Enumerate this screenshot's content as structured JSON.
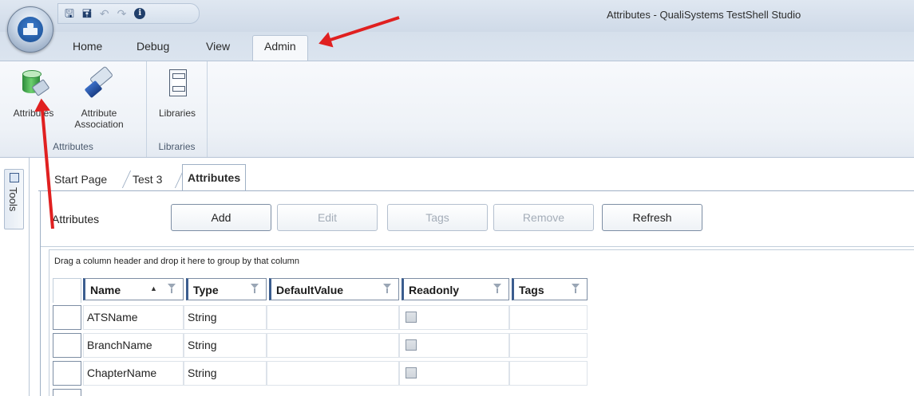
{
  "window": {
    "title": "Attributes - QualiSystems TestShell Studio"
  },
  "quick_access": {
    "icons": [
      "save-icon",
      "save-all-icon",
      "undo-icon",
      "redo-icon",
      "info-icon"
    ]
  },
  "ribbon": {
    "tabs": [
      {
        "label": "Home"
      },
      {
        "label": "Debug"
      },
      {
        "label": "View"
      },
      {
        "label": "Admin",
        "active": true
      }
    ],
    "groups": [
      {
        "label": "Attributes",
        "buttons": [
          {
            "label": "Attributes",
            "icon": "attributes-icon"
          },
          {
            "label": "Attribute Association",
            "line1": "Attribute",
            "line2": "Association",
            "icon": "attribute-association-icon"
          }
        ]
      },
      {
        "label": "Libraries",
        "buttons": [
          {
            "label": "Libraries",
            "icon": "libraries-icon"
          }
        ]
      }
    ]
  },
  "tools_strip": {
    "label": "Tools"
  },
  "document_tabs": [
    {
      "label": "Start Page"
    },
    {
      "label": "Test 3"
    },
    {
      "label": "Attributes",
      "active": true
    }
  ],
  "panel": {
    "title": "Attributes",
    "buttons": [
      {
        "label": "Add",
        "enabled": true
      },
      {
        "label": "Edit",
        "enabled": false
      },
      {
        "label": "Tags",
        "enabled": false
      },
      {
        "label": "Remove",
        "enabled": false
      },
      {
        "label": "Refresh",
        "enabled": true
      }
    ]
  },
  "grid": {
    "group_hint": "Drag a column header and drop it here to group by that column",
    "columns": [
      {
        "label": "Name",
        "sorted": "ascending"
      },
      {
        "label": "Type"
      },
      {
        "label": "DefaultValue"
      },
      {
        "label": "Readonly"
      },
      {
        "label": "Tags"
      }
    ],
    "rows": [
      {
        "name": "ATSName",
        "type": "String",
        "default_value": "",
        "readonly": false,
        "tags": ""
      },
      {
        "name": "BranchName",
        "type": "String",
        "default_value": "",
        "readonly": false,
        "tags": ""
      },
      {
        "name": "ChapterName",
        "type": "String",
        "default_value": "",
        "readonly": false,
        "tags": ""
      }
    ]
  },
  "colors": {
    "ribbon_bg": "#eef2f7",
    "title_bar": "#d6e0ec",
    "annotation_arrow": "#e02020",
    "border": "#7d8ea4"
  }
}
